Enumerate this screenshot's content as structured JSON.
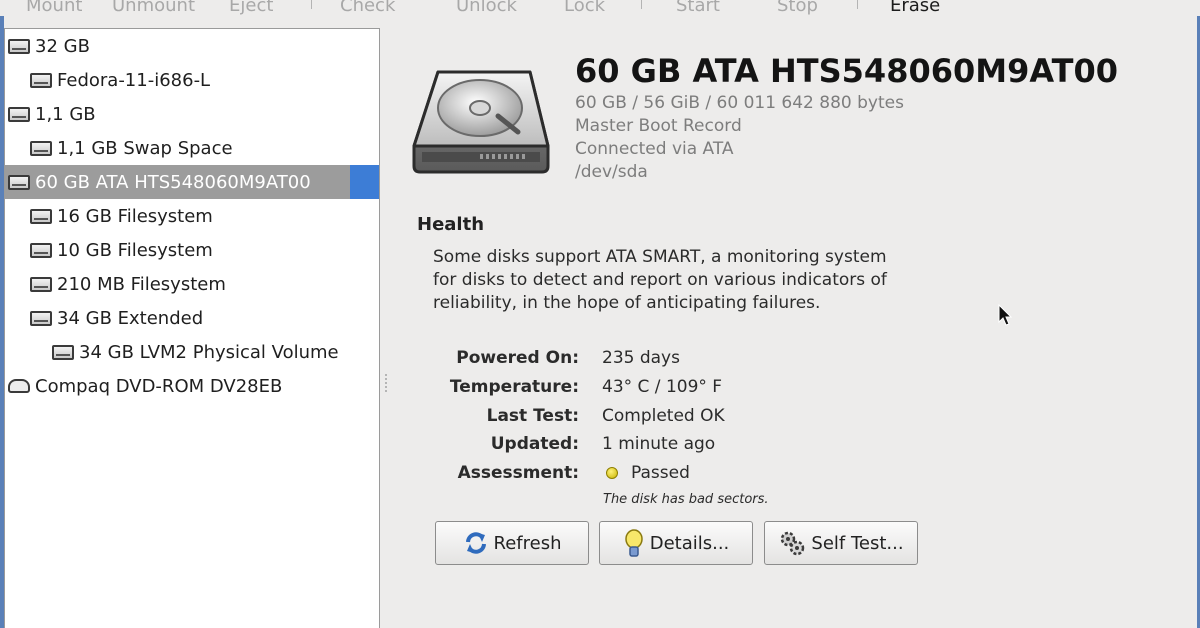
{
  "toolbar": {
    "items": [
      "Mount",
      "Unmount",
      "Eject",
      "Check",
      "Unlock",
      "Lock",
      "Start",
      "Stop",
      "Erase"
    ]
  },
  "sidebar": {
    "items": [
      {
        "label": "32 GB",
        "icon": "drive-icon",
        "level": 0
      },
      {
        "label": "Fedora-11-i686-L",
        "icon": "drive-icon",
        "level": 1
      },
      {
        "label": "1,1 GB",
        "icon": "drive-icon",
        "level": 0
      },
      {
        "label": "1,1 GB Swap Space",
        "icon": "drive-icon",
        "level": 1
      },
      {
        "label": "60 GB ATA HTS548060M9AT00",
        "icon": "drive-icon",
        "level": 0,
        "selected": true
      },
      {
        "label": "16 GB Filesystem",
        "icon": "drive-icon",
        "level": 1
      },
      {
        "label": "10 GB Filesystem",
        "icon": "drive-icon",
        "level": 1
      },
      {
        "label": "210 MB Filesystem",
        "icon": "drive-icon",
        "level": 1
      },
      {
        "label": "34 GB Extended",
        "icon": "drive-icon",
        "level": 1
      },
      {
        "label": "34 GB LVM2 Physical Volume",
        "icon": "drive-icon",
        "level": 2
      },
      {
        "label": "Compaq DVD-ROM DV28EB",
        "icon": "optical-drive-icon",
        "level": 0
      }
    ]
  },
  "disk": {
    "title": "60 GB ATA HTS548060M9AT00",
    "size": "60 GB / 56 GiB / 60 011 642 880 bytes",
    "partitioning": "Master Boot Record",
    "connection": "Connected via ATA",
    "device": "/dev/sda"
  },
  "health": {
    "heading": "Health",
    "description": "Some disks support ATA SMART, a monitoring system for disks to detect and report on various indicators of reliability, in the hope of anticipating failures.",
    "fields": [
      {
        "label": "Powered On:",
        "value": "235 days"
      },
      {
        "label": "Temperature:",
        "value": "43° C / 109° F"
      },
      {
        "label": "Last Test:",
        "value": "Completed OK"
      },
      {
        "label": "Updated:",
        "value": "1 minute ago"
      },
      {
        "label": "Assessment:",
        "value": "Passed"
      }
    ],
    "assessment_note": "The disk has bad sectors."
  },
  "buttons": {
    "refresh": "Refresh",
    "details": "Details...",
    "self_test": "Self Test..."
  },
  "colors": {
    "selection_accent": "#3d7dd6",
    "selection_row": "#9c9c9c",
    "assessment_status": "#e0cc10"
  }
}
